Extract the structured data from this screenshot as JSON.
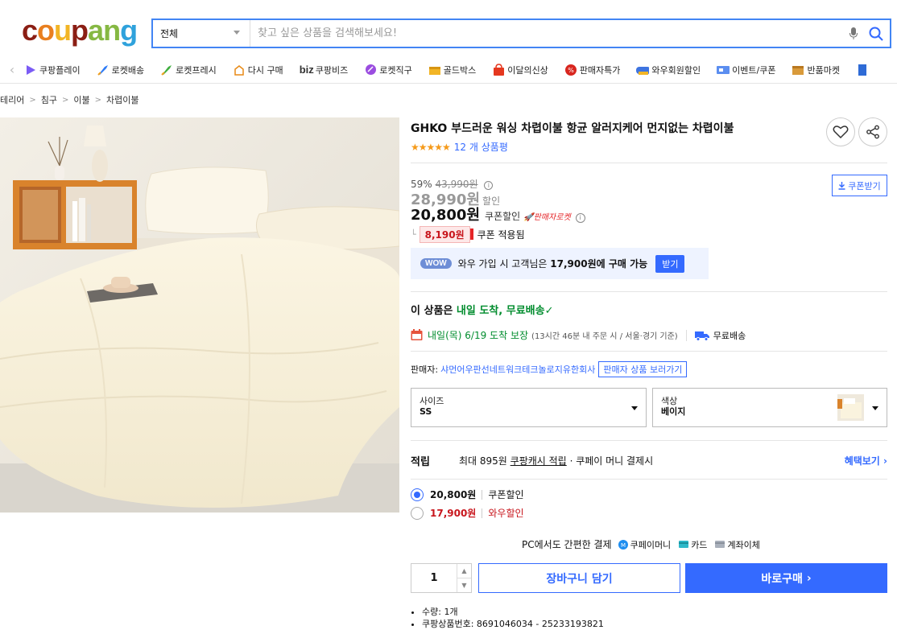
{
  "header": {
    "logo_text": "coupang",
    "search": {
      "category": "전체",
      "placeholder": "찾고 싶은 상품을 검색해보세요!"
    }
  },
  "nav": {
    "items": [
      {
        "label": "쿠팡플레이",
        "icon": "play-icon"
      },
      {
        "label": "로켓배송",
        "icon": "rocket-icon"
      },
      {
        "label": "로켓프레시",
        "icon": "rocket-fresh-icon"
      },
      {
        "label": "다시 구매",
        "icon": "rebuy-icon"
      },
      {
        "label": "쿠팡비즈",
        "prefix": "biz",
        "icon": "biz-icon"
      },
      {
        "label": "로켓직구",
        "icon": "global-icon"
      },
      {
        "label": "골드박스",
        "icon": "goldbox-icon"
      },
      {
        "label": "이달의신상",
        "icon": "new-bag-icon"
      },
      {
        "label": "판매자특가",
        "icon": "seller-deal-icon"
      },
      {
        "label": "와우회원할인",
        "icon": "wow-icon"
      },
      {
        "label": "이벤트/쿠폰",
        "icon": "coupon-icon"
      },
      {
        "label": "반품마켓",
        "icon": "return-market-icon"
      }
    ]
  },
  "breadcrumb": [
    "테리어",
    "침구",
    "이불",
    "차렵이불"
  ],
  "product": {
    "title": "GHKO 부드러운 워싱 차렵이불 항균 알러지케어 먼지없는 차렵이불",
    "stars": "★★★★★",
    "review_count": "12 개 상품평",
    "discount_rate": "59%",
    "original_price": "43,990원",
    "sale_price": "28,990원",
    "sale_label": "할인",
    "coupon_price": "20,800원",
    "coupon_label": "쿠폰할인",
    "rocket_label": "판매자로켓",
    "coupon_badge": "8,190원",
    "coupon_applied": "쿠폰 적용됨",
    "coupon_button": "쿠폰받기",
    "wow": {
      "tag": "WOW",
      "text_pre": "와우 가입 시 고객님은",
      "price": "17,900원에 구매 가능",
      "button": "받기"
    },
    "arrival_pre": "이 상품은",
    "arrival_highlight": "내일 도착, 무료배송",
    "delivery_date": "내일(목) 6/19 도착 보장",
    "delivery_note": "(13시간 46분 내 주문 시 / 서울·경기 기준)",
    "free_shipping": "무료배송",
    "seller_label": "판매자:",
    "seller_name": "샤먼어우판선네트워크테크놀로지유한회사",
    "seller_button": "판매자 상품 보러가기",
    "options": {
      "size_label": "사이즈",
      "size_value": "SS",
      "color_label": "색상",
      "color_value": "베이지"
    },
    "reward": {
      "label": "적립",
      "text_pre": "최대 895원",
      "link": "쿠팡캐시 적립",
      "text_post": "· 쿠페이 머니 결제시",
      "more": "혜택보기"
    },
    "price_options": [
      {
        "price": "20,800원",
        "label": "쿠폰할인",
        "selected": true
      },
      {
        "price": "17,900원",
        "label": "와우할인",
        "selected": false
      }
    ],
    "payment": {
      "label": "PC에서도 간편한 결제",
      "methods": [
        "쿠페이머니",
        "카드",
        "계좌이체"
      ]
    },
    "quantity": "1",
    "cart_button": "장바구니 담기",
    "buy_button": "바로구매",
    "info": [
      "수량: 1개",
      "쿠팡상품번호: 8691046034 - 25233193821"
    ]
  },
  "colors": {
    "accent": "#346aff",
    "green": "#008c2d",
    "red": "#c8161d",
    "star": "#f59a1a"
  }
}
